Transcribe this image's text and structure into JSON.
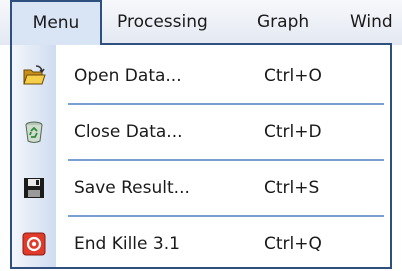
{
  "menubar": {
    "items": [
      {
        "label": "Menu"
      },
      {
        "label": "Processing"
      },
      {
        "label": "Graph"
      },
      {
        "label": "Wind"
      }
    ]
  },
  "dropdown": {
    "items": [
      {
        "icon": "open-folder-icon",
        "label": "Open Data...",
        "shortcut": "Ctrl+O"
      },
      {
        "icon": "recycle-bin-icon",
        "label": "Close Data...",
        "shortcut": "Ctrl+D"
      },
      {
        "icon": "floppy-disk-icon",
        "label": "Save Result...",
        "shortcut": "Ctrl+S"
      },
      {
        "icon": "power-icon",
        "label": "End Kille 3.1",
        "shortcut": "Ctrl+Q"
      }
    ]
  },
  "colors": {
    "menu_border": "#2f4f7f",
    "separator": "#7a9ed0",
    "power_icon": "#e03a2b"
  }
}
